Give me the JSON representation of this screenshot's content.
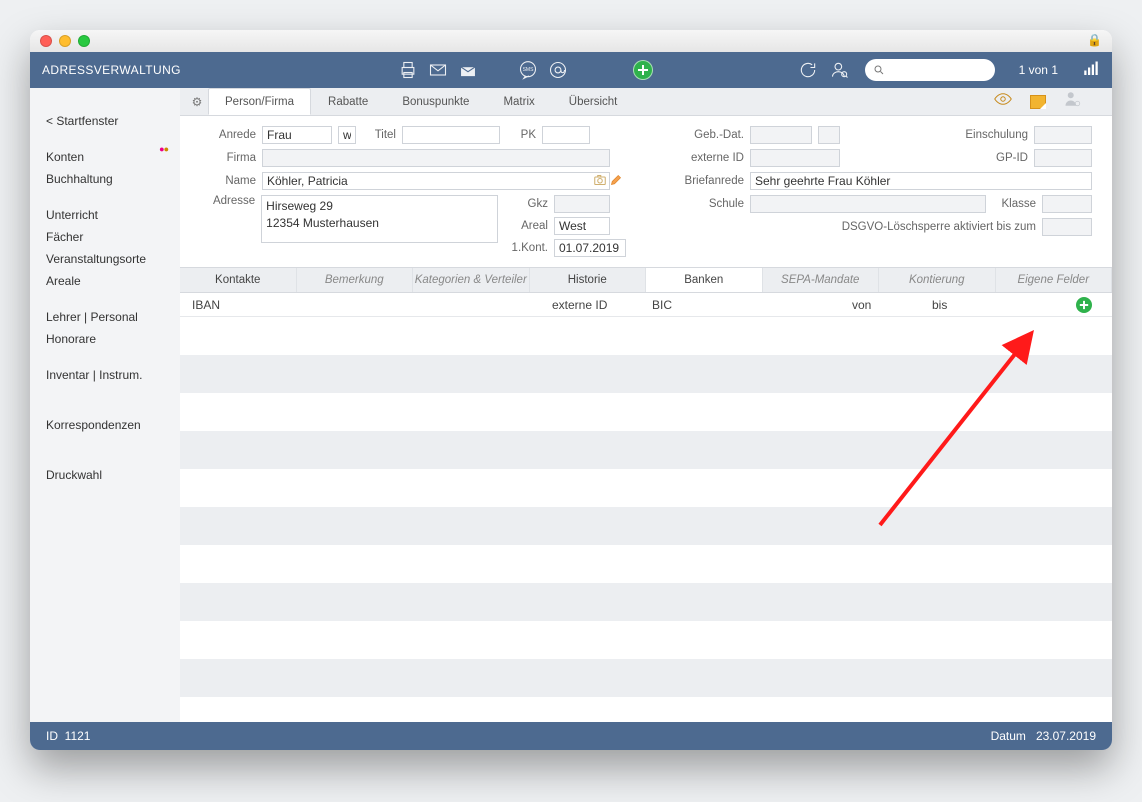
{
  "header": {
    "title": "ADRESSVERWALTUNG",
    "counter": "1 von 1"
  },
  "sidebar": {
    "back": "< Startfenster",
    "items": [
      "Konten",
      "Buchhaltung",
      "Unterricht",
      "Fächer",
      "Veranstaltungsorte",
      "Areale",
      "Lehrer | Personal",
      "Honorare",
      "Inventar | Instrum.",
      "Korrespondenzen",
      "Druckwahl"
    ]
  },
  "toptabs": [
    "Person/Firma",
    "Rabatte",
    "Bonuspunkte",
    "Matrix",
    "Übersicht"
  ],
  "form_left": {
    "anrede_label": "Anrede",
    "anrede": "Frau",
    "anrede_w": "w",
    "titel_label": "Titel",
    "titel": "",
    "pk_label": "PK",
    "pk": "",
    "firma_label": "Firma",
    "firma": "",
    "name_label": "Name",
    "name": "Köhler, Patricia",
    "adresse_label": "Adresse",
    "adresse": "Hirseweg 29\n12354 Musterhausen",
    "gkz_label": "Gkz",
    "gkz": "",
    "areal_label": "Areal",
    "areal": "West",
    "kontakt_label": "1.Kont.",
    "kontakt": "01.07.2019"
  },
  "form_right": {
    "gebdat_label": "Geb.-Dat.",
    "gebdat": "",
    "einschulung_label": "Einschulung",
    "einschulung": "",
    "externeid_label": "externe ID",
    "externeid": "",
    "gpid_label": "GP-ID",
    "gpid": "",
    "briefanrede_label": "Briefanrede",
    "briefanrede": "Sehr geehrte Frau Köhler",
    "schule_label": "Schule",
    "schule": "",
    "klasse_label": "Klasse",
    "klasse": "",
    "dsgvo_label": "DSGVO-Löschsperre aktiviert bis zum",
    "dsgvo": ""
  },
  "subtabs": [
    {
      "label": "Kontakte",
      "style": "normal"
    },
    {
      "label": "Bemerkung",
      "style": "italic"
    },
    {
      "label": "Kategorien & Verteiler",
      "style": "italic"
    },
    {
      "label": "Historie",
      "style": "normal"
    },
    {
      "label": "Banken",
      "style": "active"
    },
    {
      "label": "SEPA-Mandate",
      "style": "italic"
    },
    {
      "label": "Kontierung",
      "style": "italic"
    },
    {
      "label": "Eigene Felder",
      "style": "italic"
    }
  ],
  "grid_head": {
    "iban": "IBAN",
    "externeid": "externe ID",
    "bic": "BIC",
    "von": "von",
    "bis": "bis"
  },
  "footer": {
    "id_label": "ID",
    "id": "1121",
    "datum_label": "Datum",
    "datum": "23.07.2019"
  }
}
